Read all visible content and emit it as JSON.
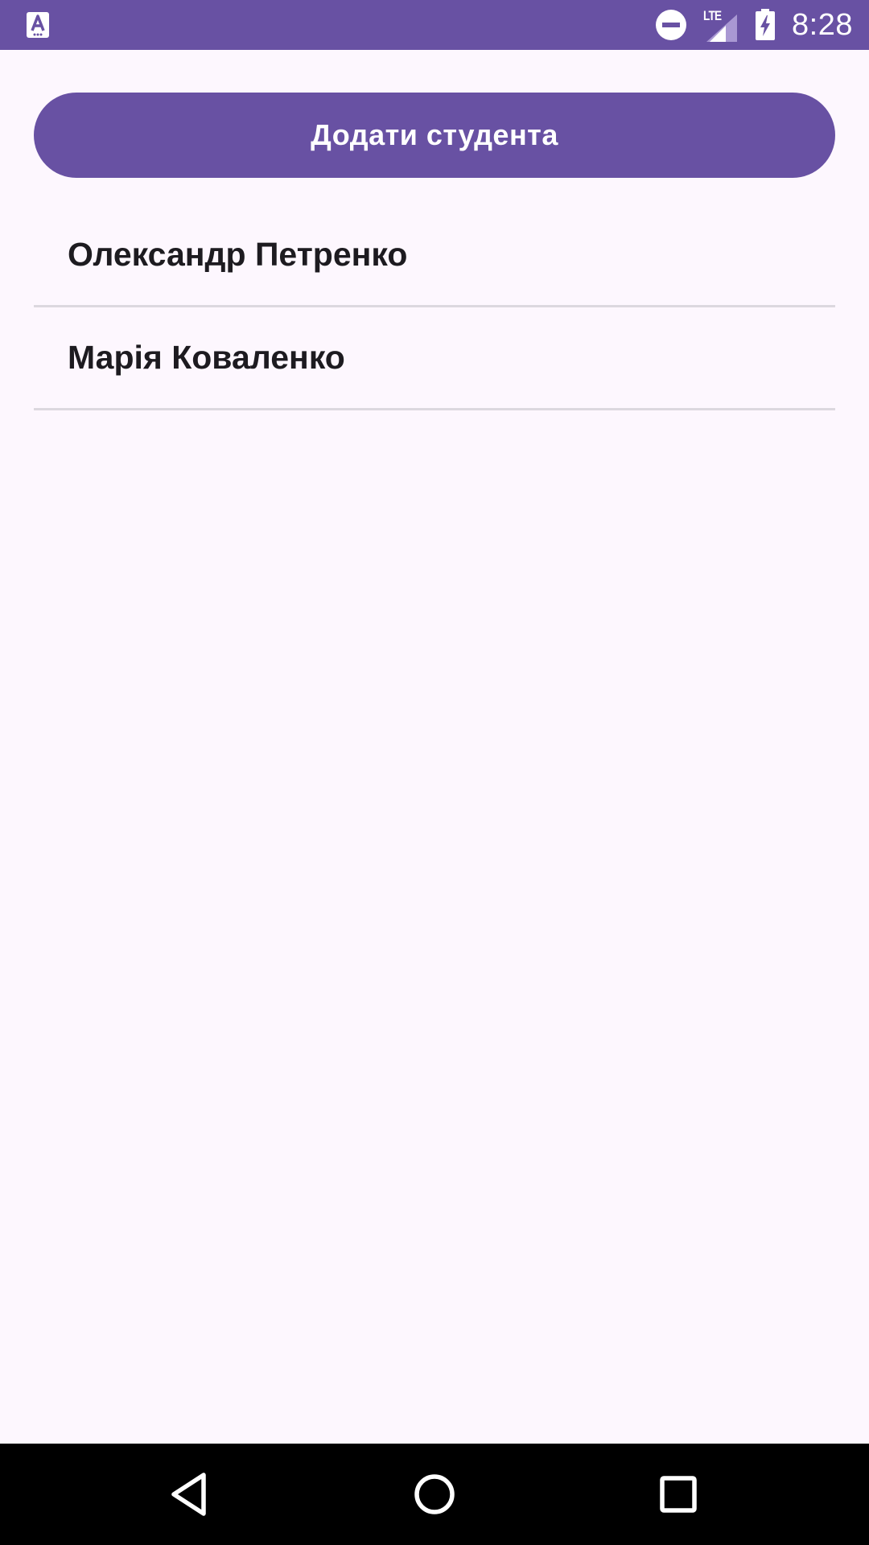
{
  "status_bar": {
    "time": "8:28",
    "network": "LTE",
    "left_icon": "app-notification-icon",
    "icons": [
      "do-not-disturb-icon",
      "lte-signal-icon",
      "battery-charging-icon"
    ],
    "background_color": "#6851A3"
  },
  "main": {
    "add_button_label": "Додати студента",
    "button_color": "#6851A3",
    "students": [
      {
        "name": "Олександр Петренко"
      },
      {
        "name": "Марія Коваленко"
      }
    ]
  },
  "navigation_bar": {
    "buttons": [
      "back-icon",
      "home-icon",
      "recents-icon"
    ]
  }
}
